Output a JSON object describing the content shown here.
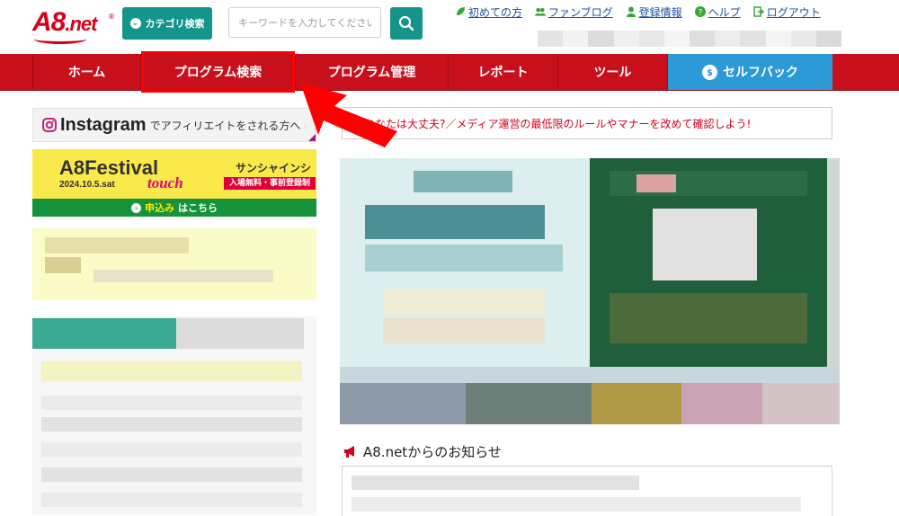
{
  "header": {
    "logo_text": "A8",
    "logo_suffix": ".net",
    "logo_reg": "®",
    "category_button": "カテゴリ検索",
    "search_placeholder": "キーワードを入力してください",
    "util_links": [
      {
        "label": "初めての方",
        "icon": "leaf-icon"
      },
      {
        "label": "ファンブログ",
        "icon": "people-icon"
      },
      {
        "label": "登録情報",
        "icon": "user-icon"
      },
      {
        "label": "ヘルプ",
        "icon": "question-icon"
      },
      {
        "label": "ログアウト",
        "icon": "logout-icon"
      }
    ]
  },
  "nav": {
    "items": [
      "ホーム",
      "プログラム検索",
      "プログラム管理",
      "レポート",
      "ツール"
    ],
    "self_back": "セルフバック"
  },
  "sidebar": {
    "instagram_title": "Instagram",
    "instagram_sub": "でアフィリエイトをされる方へ",
    "festival": {
      "title": "A8Festival",
      "subtitle": "touch",
      "date": "2024.10.5.sat",
      "venue": "サンシャインシティ",
      "entry": "入場無料・事前登録制",
      "apply_highlight": "申込み",
      "apply_rest": "はこちら"
    }
  },
  "main": {
    "notice": "あなたは大丈夫?／メディア運営の最低限のルールやマナーを改めて確認しよう!",
    "news_title": "A8.netからのお知らせ"
  },
  "colors": {
    "brand_red": "#c8101d",
    "teal": "#14948a",
    "link_blue": "#1a52a3",
    "selfback_blue": "#2b9ad6",
    "highlight": "#ff0000"
  }
}
